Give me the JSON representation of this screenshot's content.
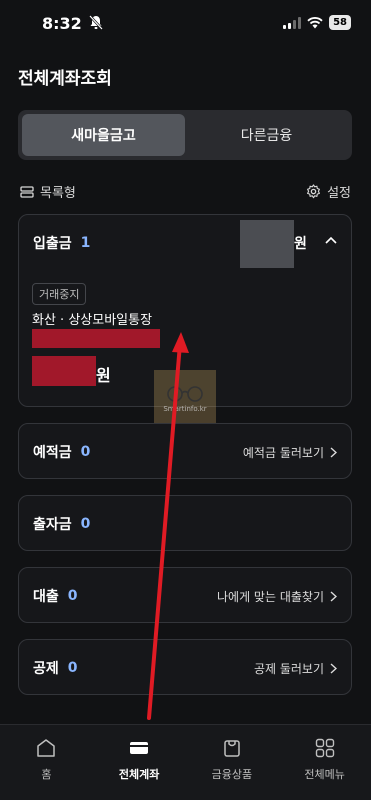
{
  "status_bar": {
    "time": "8:32",
    "battery": "58"
  },
  "page": {
    "title": "전체계좌조회"
  },
  "segment": {
    "tabs": [
      {
        "label": "새마을금고",
        "active": true
      },
      {
        "label": "다른금융",
        "active": false
      }
    ]
  },
  "toolbar": {
    "list_label": "목록형",
    "settings_label": "설정"
  },
  "deposit_card": {
    "label": "입출금",
    "count": "1",
    "balance_suffix": "원",
    "account": {
      "status_tag": "거래중지",
      "name": "화산 · 상상모바일통장",
      "balance_suffix": "원"
    }
  },
  "sections": [
    {
      "label": "예적금",
      "count": "0",
      "link": "예적금 둘러보기"
    },
    {
      "label": "출자금",
      "count": "0",
      "link": ""
    },
    {
      "label": "대출",
      "count": "0",
      "link": "나에게 맞는 대출찾기"
    },
    {
      "label": "공제",
      "count": "0",
      "link": "공제 둘러보기"
    }
  ],
  "watermark": {
    "text": "Smartinfo.kr"
  },
  "tabbar": {
    "items": [
      {
        "label": "홈",
        "icon": "home-icon"
      },
      {
        "label": "전체계좌",
        "icon": "wallet-icon",
        "active": true
      },
      {
        "label": "금융상품",
        "icon": "bag-icon"
      },
      {
        "label": "전체메뉴",
        "icon": "grid-menu-icon"
      }
    ]
  },
  "colors": {
    "background": "#111214",
    "accent_count": "#8ab6ff",
    "redaction": "#a1182a",
    "annotation_arrow": "#e01b24"
  }
}
